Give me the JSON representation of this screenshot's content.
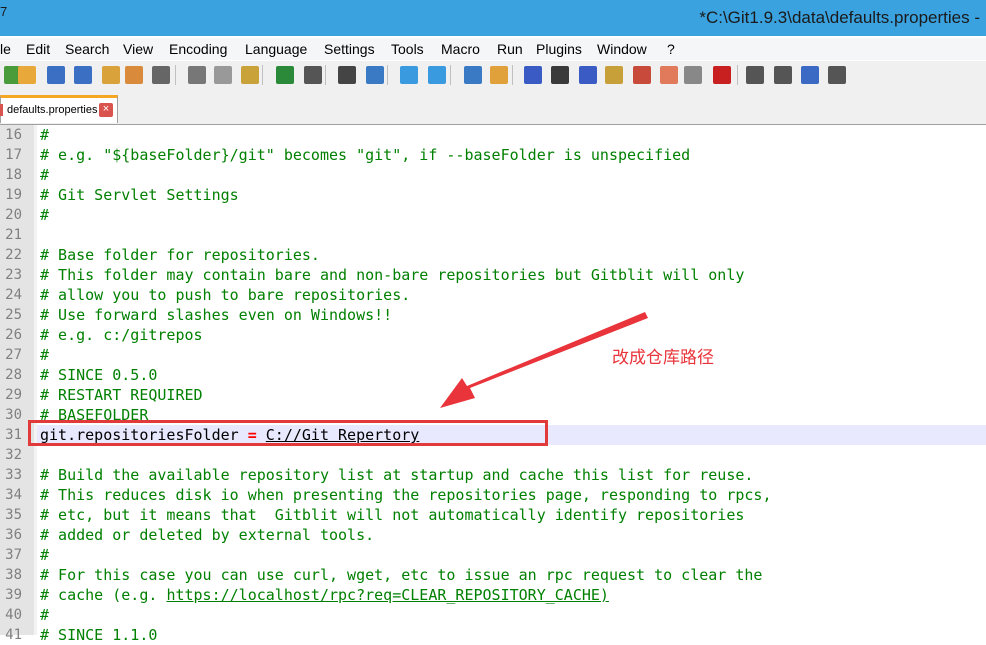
{
  "window": {
    "title": "*C:\\Git1.9.3\\data\\defaults.properties -",
    "corner_char": "7"
  },
  "menu": [
    "le",
    "Edit",
    "Search",
    "View",
    "Encoding",
    "Language",
    "Settings",
    "Tools",
    "Macro",
    "Run",
    "Plugins",
    "Window",
    "?"
  ],
  "toolbar_icons": [
    "new-file-icon",
    "open-file-icon",
    "save-icon",
    "save-all-icon",
    "close-icon",
    "close-all-icon",
    "print-icon",
    "cut-icon",
    "copy-icon",
    "paste-icon",
    "undo-icon",
    "redo-icon",
    "find-icon",
    "replace-icon",
    "zoom-in-icon",
    "zoom-out-icon",
    "sync-vertical-icon",
    "sync-horizontal-icon",
    "word-wrap-icon",
    "show-all-chars-icon",
    "indent-guide-icon",
    "doc-map-icon",
    "function-list-icon",
    "folder-as-workspace-icon",
    "monitoring-icon",
    "record-macro-icon",
    "stop-record-icon",
    "play-macro-icon",
    "run-macro-multiple-icon",
    "save-macro-icon"
  ],
  "tab": {
    "label": "defaults.properties",
    "close": "×"
  },
  "lines": [
    {
      "n": "16",
      "text": "#"
    },
    {
      "n": "17",
      "text": "# e.g. \"${baseFolder}/git\" becomes \"git\", if --baseFolder is unspecified"
    },
    {
      "n": "18",
      "text": "#"
    },
    {
      "n": "19",
      "text": "# Git Servlet Settings"
    },
    {
      "n": "20",
      "text": "#"
    },
    {
      "n": "21",
      "text": ""
    },
    {
      "n": "22",
      "text": "# Base folder for repositories."
    },
    {
      "n": "23",
      "text": "# This folder may contain bare and non-bare repositories but Gitblit will only"
    },
    {
      "n": "24",
      "text": "# allow you to push to bare repositories."
    },
    {
      "n": "25",
      "text": "# Use forward slashes even on Windows!!"
    },
    {
      "n": "26",
      "text": "# e.g. c:/gitrepos"
    },
    {
      "n": "27",
      "text": "#"
    },
    {
      "n": "28",
      "text": "# SINCE 0.5.0"
    },
    {
      "n": "29",
      "text": "# RESTART REQUIRED"
    },
    {
      "n": "30",
      "text": "# BASEFOLDER"
    },
    {
      "n": "31",
      "key": "git.repositoriesFolder ",
      "eq": "=",
      "val": "C://Git_Repertory"
    },
    {
      "n": "32",
      "text": ""
    },
    {
      "n": "33",
      "text": "# Build the available repository list at startup and cache this list for reuse."
    },
    {
      "n": "34",
      "text": "# This reduces disk io when presenting the repositories page, responding to rpcs,"
    },
    {
      "n": "35",
      "text": "# etc, but it means that  Gitblit will not automatically identify repositories"
    },
    {
      "n": "36",
      "text": "# added or deleted by external tools."
    },
    {
      "n": "37",
      "text": "#"
    },
    {
      "n": "38",
      "text": "# For this case you can use curl, wget, etc to issue an rpc request to clear the"
    },
    {
      "n": "39",
      "text": "# cache (e.g. ",
      "url": "https://localhost/rpc?req=CLEAR_REPOSITORY_CACHE)"
    },
    {
      "n": "40",
      "text": "#"
    },
    {
      "n": "41",
      "text": "# SINCE 1.1.0"
    }
  ],
  "annotation": {
    "text": "改成仓库路径"
  },
  "colors": {
    "titlebar": "#3ba2e0",
    "comment": "#008000",
    "annotation": "#e8343a"
  }
}
